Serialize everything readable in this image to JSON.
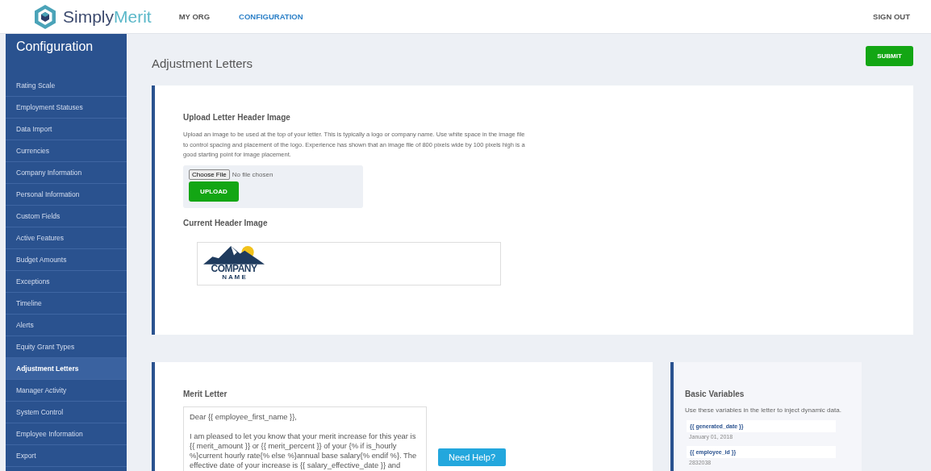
{
  "header": {
    "brand": {
      "prefix": "Simply",
      "suffix": "Merit"
    },
    "nav": [
      {
        "label": "MY ORG",
        "selected": false
      },
      {
        "label": "CONFIGURATION",
        "selected": true
      }
    ],
    "sign_out": "SIGN OUT"
  },
  "sidebar": {
    "title": "Configuration",
    "items": [
      {
        "label": "Rating Scale",
        "selected": false
      },
      {
        "label": "Employment Statuses",
        "selected": false
      },
      {
        "label": "Data Import",
        "selected": false
      },
      {
        "label": "Currencies",
        "selected": false
      },
      {
        "label": "Company Information",
        "selected": false
      },
      {
        "label": "Personal Information",
        "selected": false
      },
      {
        "label": "Custom Fields",
        "selected": false
      },
      {
        "label": "Active Features",
        "selected": false
      },
      {
        "label": "Budget Amounts",
        "selected": false
      },
      {
        "label": "Exceptions",
        "selected": false
      },
      {
        "label": "Timeline",
        "selected": false
      },
      {
        "label": "Alerts",
        "selected": false
      },
      {
        "label": "Equity Grant Types",
        "selected": false
      },
      {
        "label": "Adjustment Letters",
        "selected": true
      },
      {
        "label": "Manager Activity",
        "selected": false
      },
      {
        "label": "System Control",
        "selected": false
      },
      {
        "label": "Employee Information",
        "selected": false
      },
      {
        "label": "Export",
        "selected": false
      }
    ]
  },
  "page": {
    "title": "Adjustment Letters",
    "submit": "SUBMIT"
  },
  "upload": {
    "heading": "Upload Letter Header Image",
    "description": "Upload an image to be used at the top of your letter. This is typically a logo or company name. Use white space in the image file to control spacing and placement of the logo. Experience has shown that an image file of 800 pixels wide by 100 pixels high is a good starting point for image placement.",
    "choose_button": "Choose File",
    "file_status": "No file chosen",
    "upload_button": "UPLOAD",
    "current_heading": "Current Header Image",
    "image_text": {
      "line_1": "COMPANY",
      "line_2": "N A M E"
    }
  },
  "merit_letter": {
    "heading": "Merit Letter",
    "value": "Dear {{ employee_first_name }},\n\nI am pleased to let you know that your merit increase for this year is {{ merit_amount }} or {{ merit_percent }} of your {% if is_hourly %}current hourly rate{% else %}annual base salary{% endif %}. The effective date of your increase is {{ salary_effective_date }} and"
  },
  "variables": {
    "heading": "Basic Variables",
    "description": "Use these variables in the letter to inject dynamic data.",
    "items": [
      {
        "name": "{{ generated_date }}",
        "example": "January 01, 2018"
      },
      {
        "name": "{{ employee_id }}",
        "example": "2832038"
      }
    ]
  },
  "help_button": "Need Help?"
}
